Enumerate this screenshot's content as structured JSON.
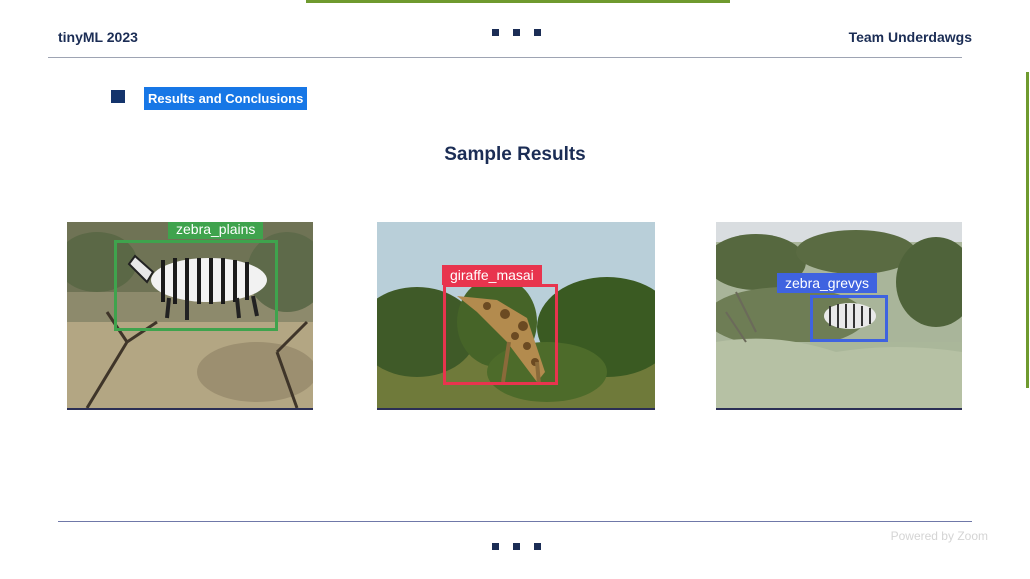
{
  "header": {
    "left_text": "tinyML 2023",
    "right_text": "Team Underdawgs"
  },
  "section": {
    "title": "Results and Conclusions"
  },
  "slide": {
    "title": "Sample Results"
  },
  "results": [
    {
      "label": "zebra_plains",
      "color": "#3fa34d"
    },
    {
      "label": "giraffe_masai",
      "color": "#e8344e"
    },
    {
      "label": "zebra_grevys",
      "color": "#3f63e0"
    }
  ],
  "watermark": "Powered by Zoom",
  "colors": {
    "navy": "#1b2d55",
    "accent_green": "#6f9a2f",
    "highlight_blue": "#1777e6"
  }
}
